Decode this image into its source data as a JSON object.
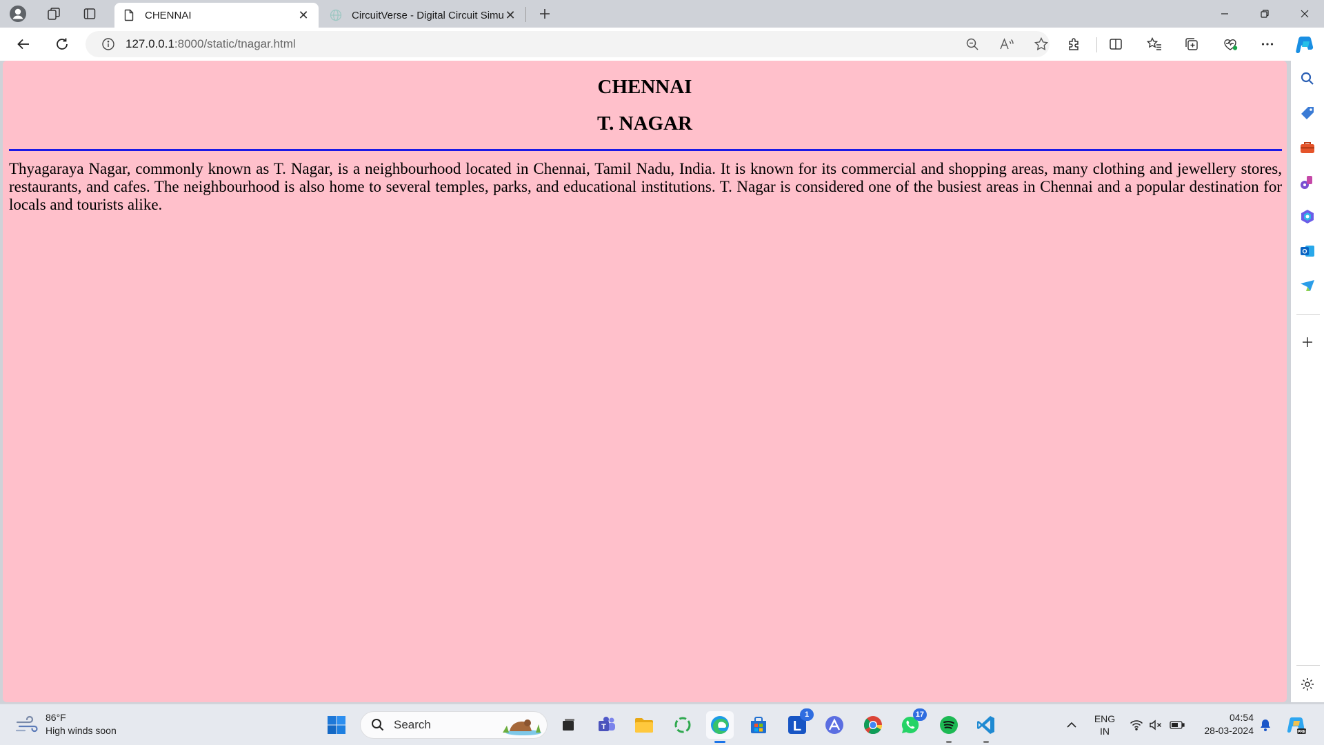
{
  "browser": {
    "tabs": [
      {
        "title": "CHENNAI",
        "active": true
      },
      {
        "title": "CircuitVerse - Digital Circuit Simu",
        "active": false
      }
    ],
    "address": {
      "host": "127.0.0.1",
      "path": ":8000/static/tnagar.html"
    }
  },
  "page": {
    "background_color": "#ffc0cb",
    "rule_color": "#1a1ae6",
    "heading_city": "CHENNAI",
    "heading_area": "T. NAGAR",
    "paragraph": "Thyagaraya Nagar, commonly known as T. Nagar, is a neighbourhood located in Chennai, Tamil Nadu, India. It is known for its commercial and shopping areas, many clothing and jewellery stores, restaurants, and cafes. The neighbourhood is also home to several temples, parks, and educational institutions. T. Nagar is considered one of the busiest areas in Chennai and a popular destination for locals and tourists alike."
  },
  "taskbar": {
    "weather_temp": "86°F",
    "weather_desc": "High winds soon",
    "search_label": "Search",
    "badges": {
      "l_app": "1",
      "whatsapp": "17"
    },
    "lang_line1": "ENG",
    "lang_line2": "IN",
    "time": "04:54",
    "date": "28-03-2024"
  }
}
